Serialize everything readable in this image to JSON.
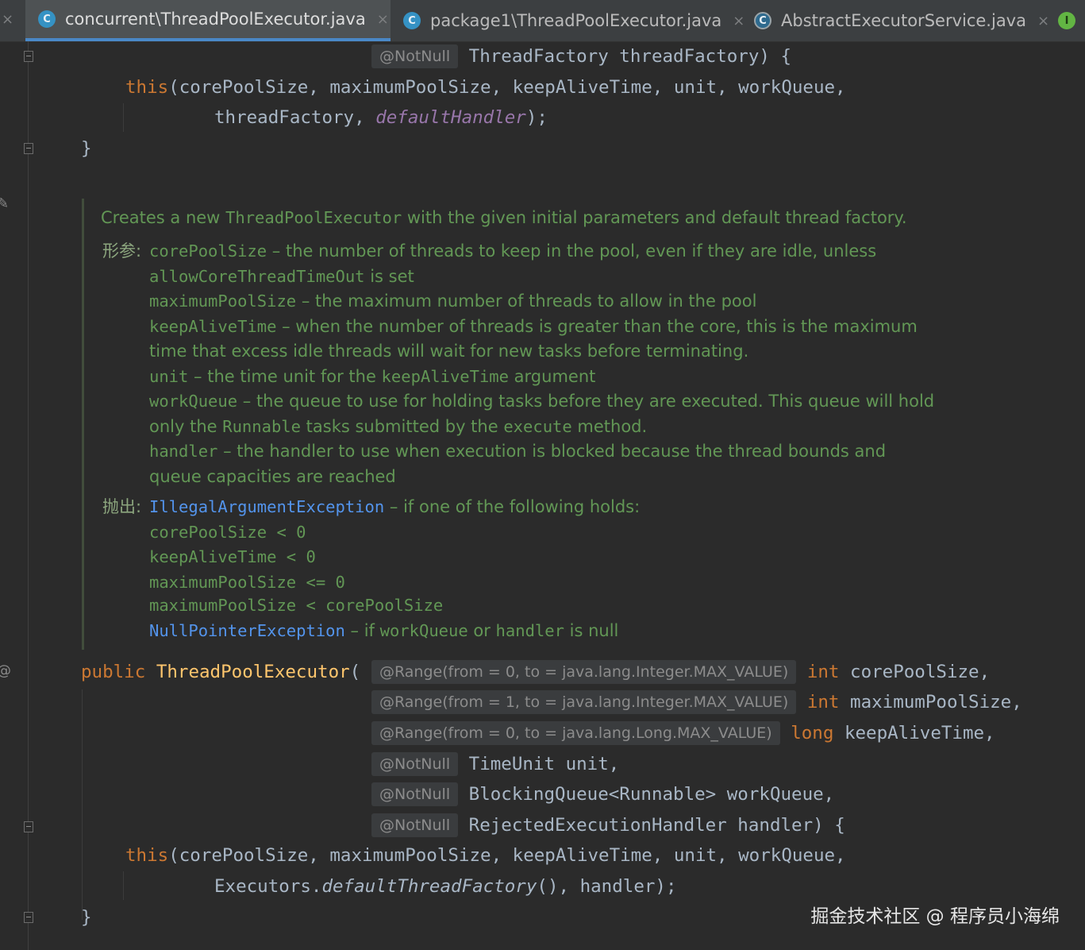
{
  "tabs": [
    {
      "label": "concurrent\\ThreadPoolExecutor.java",
      "icon": "class-icon",
      "icon_glyph": "C",
      "active": true
    },
    {
      "label": "package1\\ThreadPoolExecutor.java",
      "icon": "class-icon",
      "icon_glyph": "C",
      "active": false
    },
    {
      "label": "AbstractExecutorService.java",
      "icon": "abstract-class-icon",
      "icon_glyph": "C",
      "active": false
    },
    {
      "icon": "interface-icon",
      "icon_glyph": "I"
    }
  ],
  "glyphs": {
    "close": "×",
    "ann_gutter": "@",
    "edit_gutter": "✎"
  },
  "code_top": {
    "l1_ann": "@NotNull",
    "l1_rest": " ThreadFactory threadFactory) {",
    "l2_kw": "this",
    "l2_rest": "(corePoolSize, maximumPoolSize, keepAliveTime, unit, workQueue,",
    "l3_rest": "threadFactory, ",
    "l3_it": "defaultHandler",
    "l3_end": ");",
    "l4": "}"
  },
  "doc": {
    "summary_pre": "Creates a new ",
    "summary_code": "ThreadPoolExecutor",
    "summary_post": " with the given initial parameters and default thread factory.",
    "params_label": "形参:",
    "params": [
      {
        "name": "corePoolSize",
        "desc": " – the number of threads to keep in the pool, even if they are idle, unless"
      },
      {
        "code": "allowCoreThreadTimeOut",
        "desc": " is set"
      },
      {
        "name": "maximumPoolSize",
        "desc": " – the maximum number of threads to allow in the pool"
      },
      {
        "name": "keepAliveTime",
        "desc": " – when the number of threads is greater than the core, this is the maximum"
      },
      {
        "desc": "time that excess idle threads will wait for new tasks before terminating."
      },
      {
        "name": "unit",
        "desc": " – the time unit for the ",
        "code": "keepAliveTime",
        "desc2": " argument"
      },
      {
        "name": "workQueue",
        "desc": " – the queue to use for holding tasks before they are executed. This queue will hold"
      },
      {
        "pre": "only the ",
        "code": "Runnable",
        "desc": " tasks submitted by the ",
        "code2": "execute",
        "desc2": " method."
      },
      {
        "name": "handler",
        "desc": " – the handler to use when execution is blocked because the thread bounds and"
      },
      {
        "desc": "queue capacities are reached"
      }
    ],
    "throws_label": "抛出:",
    "throws": [
      {
        "link": "IllegalArgumentException",
        "desc": " – if one of the following holds:"
      },
      {
        "code": "corePoolSize < 0"
      },
      {
        "code": "keepAliveTime < 0"
      },
      {
        "code": "maximumPoolSize <= 0"
      },
      {
        "code": "maximumPoolSize < corePoolSize"
      },
      {
        "link": "NullPointerException",
        "desc": " – if ",
        "code": "workQueue",
        "desc2": " or ",
        "code2": "handler",
        "desc3": " is null"
      }
    ]
  },
  "code_bottom": {
    "sig_kw": "public",
    "sig_name": "ThreadPoolExecutor",
    "sig_open": "(",
    "p1_ann": "@Range(from = 0, to = java.lang.Integer.MAX_VALUE)",
    "p1_type": "int",
    "p1_name": " corePoolSize,",
    "p2_ann": "@Range(from = 1, to = java.lang.Integer.MAX_VALUE)",
    "p2_type": "int",
    "p2_name": " maximumPoolSize,",
    "p3_ann": "@Range(from = 0, to = java.lang.Long.MAX_VALUE)",
    "p3_type": "long",
    "p3_name": " keepAliveTime,",
    "p4_ann": "@NotNull",
    "p4_rest": " TimeUnit unit,",
    "p5_ann": "@NotNull",
    "p5_rest": " BlockingQueue<Runnable> workQueue,",
    "p6_ann": "@NotNull",
    "p6_rest": " RejectedExecutionHandler handler) {",
    "b1_kw": "this",
    "b1_rest": "(corePoolSize, maximumPoolSize, keepAliveTime, unit, workQueue,",
    "b2_pre": "Executors.",
    "b2_it": "defaultThreadFactory",
    "b2_post": "(), handler);",
    "close": "}"
  },
  "watermark": "掘金技术社区 @ 程序员小海绵"
}
